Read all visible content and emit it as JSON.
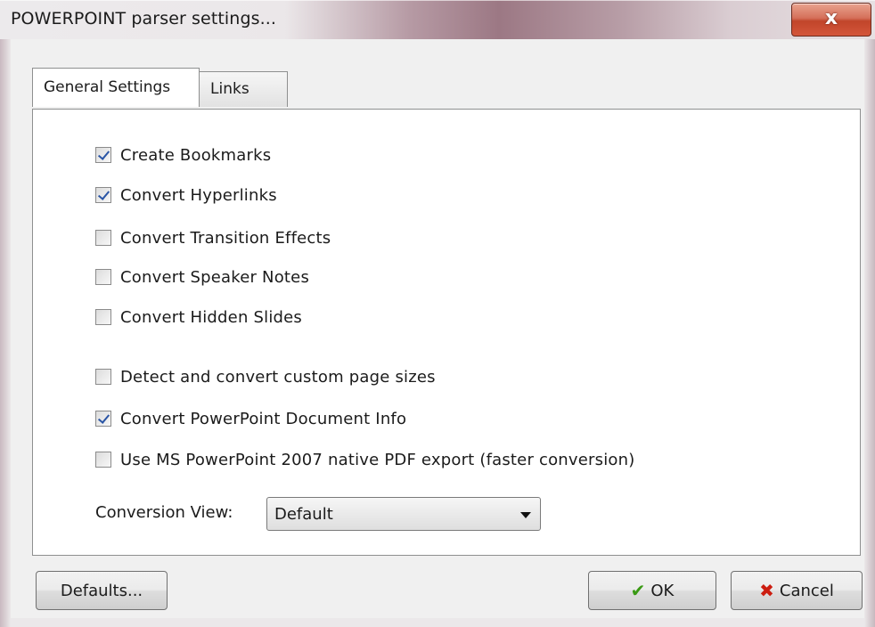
{
  "window": {
    "title": "POWERPOINT parser settings...",
    "close_glyph": "x"
  },
  "tabs": [
    {
      "label": "General Settings",
      "active": true
    },
    {
      "label": "Links",
      "active": false
    }
  ],
  "options": [
    {
      "label": "Create Bookmarks",
      "checked": true
    },
    {
      "label": "Convert Hyperlinks",
      "checked": true
    },
    {
      "label": "Convert Transition Effects",
      "checked": false
    },
    {
      "label": "Convert Speaker Notes",
      "checked": false
    },
    {
      "label": "Convert Hidden Slides",
      "checked": false
    },
    {
      "label": "Detect and convert custom page sizes",
      "checked": false
    },
    {
      "label": "Convert PowerPoint Document Info",
      "checked": true
    },
    {
      "label": "Use MS PowerPoint 2007 native PDF export (faster conversion)",
      "checked": false
    }
  ],
  "conversion_view": {
    "label": "Conversion View:",
    "value": "Default"
  },
  "buttons": {
    "defaults": "Defaults...",
    "ok": "OK",
    "cancel": "Cancel"
  },
  "icons": {
    "ok": "checkmark-icon",
    "cancel": "red-x-icon",
    "close": "close-icon"
  },
  "colors": {
    "close_button": "#c1452a",
    "checkmark": "#2a55a5",
    "ok_icon": "#3a9a14",
    "cancel_icon": "#cc1d10"
  }
}
